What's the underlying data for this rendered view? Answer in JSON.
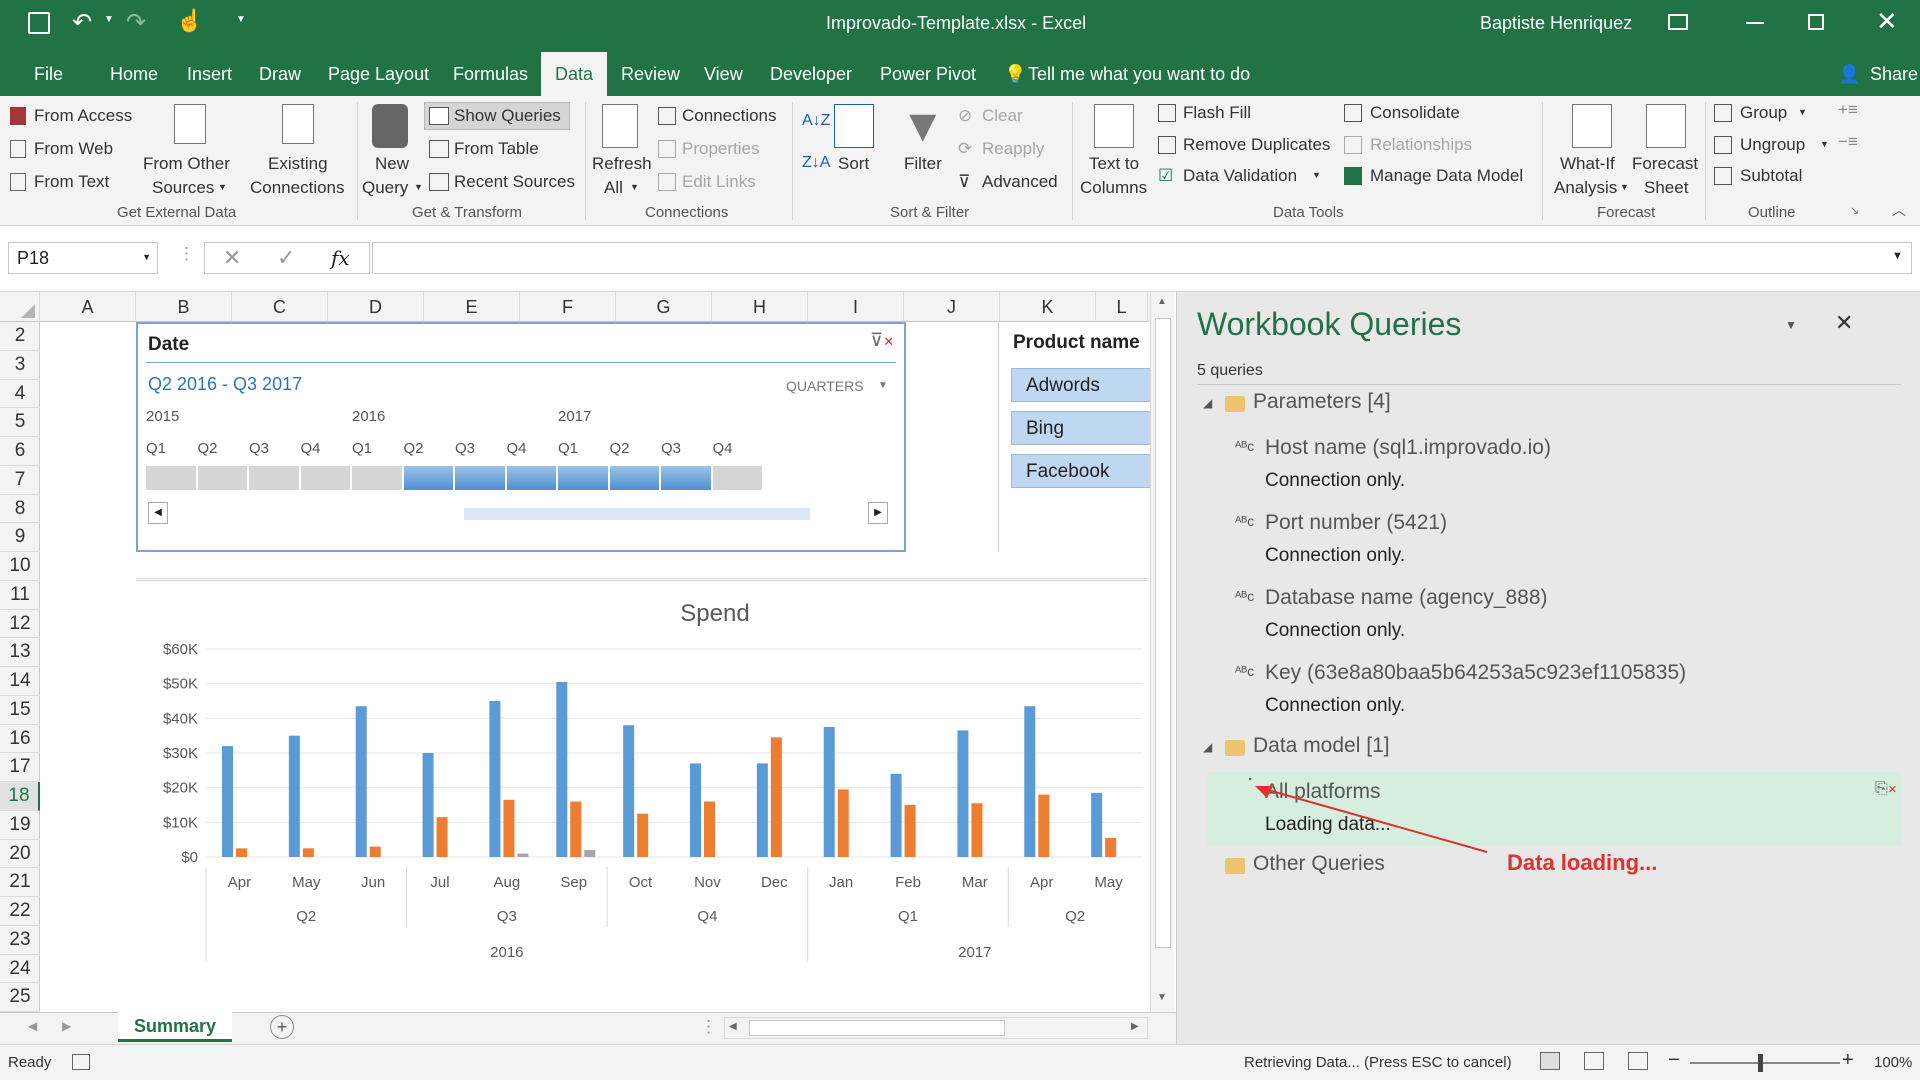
{
  "window": {
    "title": "Improvado-Template.xlsx  -  Excel",
    "user": "Baptiste Henriquez",
    "share": "Share"
  },
  "tabs": [
    "File",
    "Home",
    "Insert",
    "Draw",
    "Page Layout",
    "Formulas",
    "Data",
    "Review",
    "View",
    "Developer",
    "Power Pivot"
  ],
  "active_tab": "Data",
  "tell_me": "Tell me what you want to do",
  "ribbon": {
    "get_external": {
      "from_access": "From Access",
      "from_web": "From Web",
      "from_text": "From Text",
      "from_other_1": "From Other",
      "from_other_2": "Sources",
      "existing_1": "Existing",
      "existing_2": "Connections",
      "group": "Get External Data"
    },
    "get_transform": {
      "new_query_1": "New",
      "new_query_2": "Query",
      "show_queries": "Show Queries",
      "from_table": "From Table",
      "recent_sources": "Recent Sources",
      "group": "Get & Transform"
    },
    "connections": {
      "refresh_1": "Refresh",
      "refresh_2": "All",
      "connections": "Connections",
      "properties": "Properties",
      "edit_links": "Edit Links",
      "group": "Connections"
    },
    "sort_filter": {
      "sort": "Sort",
      "filter": "Filter",
      "clear": "Clear",
      "reapply": "Reapply",
      "advanced": "Advanced",
      "group": "Sort & Filter"
    },
    "data_tools": {
      "text_to_1": "Text to",
      "text_to_2": "Columns",
      "flash_fill": "Flash Fill",
      "remove_duplicates": "Remove Duplicates",
      "data_validation": "Data Validation",
      "consolidate": "Consolidate",
      "relationships": "Relationships",
      "manage_data_model": "Manage Data Model",
      "group": "Data Tools"
    },
    "forecast": {
      "what_if_1": "What-If",
      "what_if_2": "Analysis",
      "forecast_1": "Forecast",
      "forecast_2": "Sheet",
      "group": "Forecast"
    },
    "outline": {
      "group_btn": "Group",
      "ungroup": "Ungroup",
      "subtotal": "Subtotal",
      "group": "Outline"
    }
  },
  "formula_bar": {
    "name_box": "P18",
    "fx": "fx",
    "value": ""
  },
  "columns": [
    "A",
    "B",
    "C",
    "D",
    "E",
    "F",
    "G",
    "H",
    "I",
    "J",
    "K",
    "L"
  ],
  "rows": [
    "2",
    "3",
    "4",
    "5",
    "6",
    "7",
    "8",
    "9",
    "10",
    "11",
    "12",
    "13",
    "14",
    "15",
    "16",
    "17",
    "18",
    "19",
    "20",
    "21",
    "22",
    "23",
    "24",
    "25"
  ],
  "selected_row": "18",
  "date_slicer": {
    "title": "Date",
    "range": "Q2 2016 - Q3 2017",
    "level": "QUARTERS",
    "years": [
      "2015",
      "2016",
      "2017"
    ],
    "quarters": [
      "Q1",
      "Q2",
      "Q3",
      "Q4",
      "Q1",
      "Q2",
      "Q3",
      "Q4",
      "Q1",
      "Q2",
      "Q3",
      "Q4"
    ],
    "selected_from": 5,
    "selected_to": 10
  },
  "product_slicer": {
    "title": "Product name",
    "items": [
      "Adwords",
      "Bing",
      "Facebook"
    ]
  },
  "chart_data": {
    "type": "bar",
    "title": "Spend",
    "categories": [
      "Apr",
      "May",
      "Jun",
      "Jul",
      "Aug",
      "Sep",
      "Oct",
      "Nov",
      "Dec",
      "Jan",
      "Feb",
      "Mar",
      "Apr",
      "May"
    ],
    "quarters": [
      {
        "label": "Q2",
        "span": 3
      },
      {
        "label": "Q3",
        "span": 3
      },
      {
        "label": "Q4",
        "span": 3
      },
      {
        "label": "Q1",
        "span": 3
      },
      {
        "label": "Q2",
        "span": 2
      }
    ],
    "years": [
      {
        "label": "2016",
        "span": 9
      },
      {
        "label": "2017",
        "span": 5
      }
    ],
    "series": [
      {
        "color": "#5b9bd5",
        "values": [
          32000,
          35000,
          43500,
          30000,
          45000,
          50500,
          38000,
          27000,
          27000,
          37500,
          24000,
          36500,
          43500,
          18500
        ]
      },
      {
        "color": "#ed7d31",
        "values": [
          2500,
          2500,
          3000,
          11500,
          16500,
          16000,
          12500,
          16000,
          34500,
          19500,
          15000,
          15500,
          18000,
          5500
        ]
      },
      {
        "color": "#a5a5a5",
        "values": [
          0,
          0,
          0,
          0,
          1000,
          2000,
          0,
          0,
          0,
          0,
          0,
          0,
          0,
          0
        ]
      }
    ],
    "yticks": [
      "$0",
      "$10K",
      "$20K",
      "$30K",
      "$40K",
      "$50K",
      "$60K"
    ],
    "ylim": [
      0,
      60000
    ]
  },
  "queries_pane": {
    "title": "Workbook Queries",
    "count": "5 queries",
    "parameters": "Parameters",
    "parameters_count": "[4]",
    "params": [
      {
        "name": "Host name (sql1.improvado.io)",
        "status": "Connection only."
      },
      {
        "name": "Port number (5421)",
        "status": "Connection only."
      },
      {
        "name": "Database name (agency_888)",
        "status": "Connection only."
      },
      {
        "name": "Key (63e8a80baa5b64253a5c923ef1105835)",
        "status": "Connection only."
      }
    ],
    "data_model": "Data model",
    "data_model_count": "[1]",
    "all_platforms": "All platforms",
    "loading": "Loading data...",
    "other_queries": "Other Queries",
    "annotation": "Data loading..."
  },
  "sheet_tab": "Summary",
  "status": {
    "ready": "Ready",
    "retrieving": "Retrieving Data... (Press ESC to cancel)",
    "zoom": "100%"
  }
}
